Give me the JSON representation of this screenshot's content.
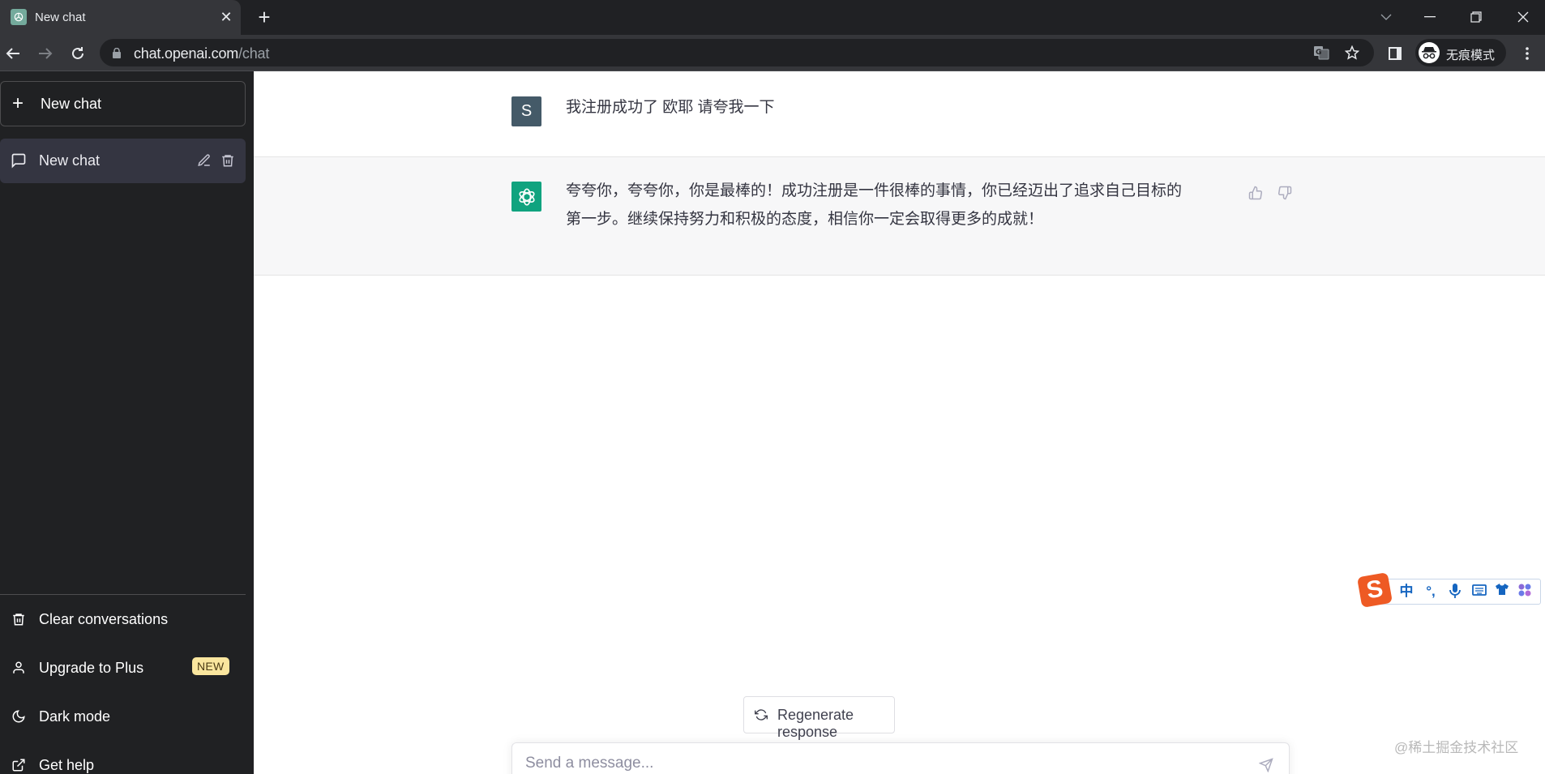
{
  "browser": {
    "tab_title": "New chat",
    "url_host": "chat.openai.com",
    "url_path": "/chat",
    "profile_label": "无痕模式",
    "icons": {
      "favicon": "openai-logo-icon",
      "tab_close": "close-icon",
      "new_tab": "plus-icon",
      "tab_search": "chevron-down-icon",
      "minimize": "minimize-icon",
      "restore": "restore-icon",
      "close_window": "close-icon",
      "back": "arrow-left-icon",
      "forward": "arrow-right-icon",
      "reload": "reload-icon",
      "lock": "lock-icon",
      "translate": "translate-icon",
      "bookmark": "star-icon",
      "side_panel": "side-panel-icon",
      "incognito": "incognito-icon",
      "menu": "kebab-menu-icon"
    }
  },
  "sidebar": {
    "new_chat_label": "New chat",
    "conversations": [
      {
        "label": "New chat",
        "active": true
      }
    ],
    "bottom_items": [
      {
        "label": "Clear conversations",
        "icon": "trash-icon"
      },
      {
        "label": "Upgrade to Plus",
        "icon": "user-icon",
        "badge": "NEW"
      },
      {
        "label": "Dark mode",
        "icon": "moon-icon"
      },
      {
        "label": "Get help",
        "icon": "external-link-icon"
      }
    ]
  },
  "chat": {
    "messages": [
      {
        "role": "user",
        "avatar_letter": "S",
        "text": "我注册成功了 欧耶 请夸我一下"
      },
      {
        "role": "assistant",
        "line1": "夸夸你，夸夸你，你是最棒的！成功注册是一件很棒的事情，你已经迈出了追求自己目标的",
        "line2": "第一步。继续保持努力和积极的态度，相信你一定会取得更多的成就！"
      }
    ],
    "regenerate_label": "Regenerate response",
    "input_value": "",
    "input_placeholder": "Send a message..."
  },
  "colors": {
    "accent": "#10a37f",
    "sidebar_bg": "#202123",
    "user_avatar": "#445a68",
    "badge_bg": "#fae69e"
  },
  "ime": {
    "items": [
      "中",
      "°,",
      "mic-icon",
      "keyboard-icon",
      "skin-icon",
      "apps-icon"
    ]
  },
  "watermark": "@稀土掘金技术社区"
}
